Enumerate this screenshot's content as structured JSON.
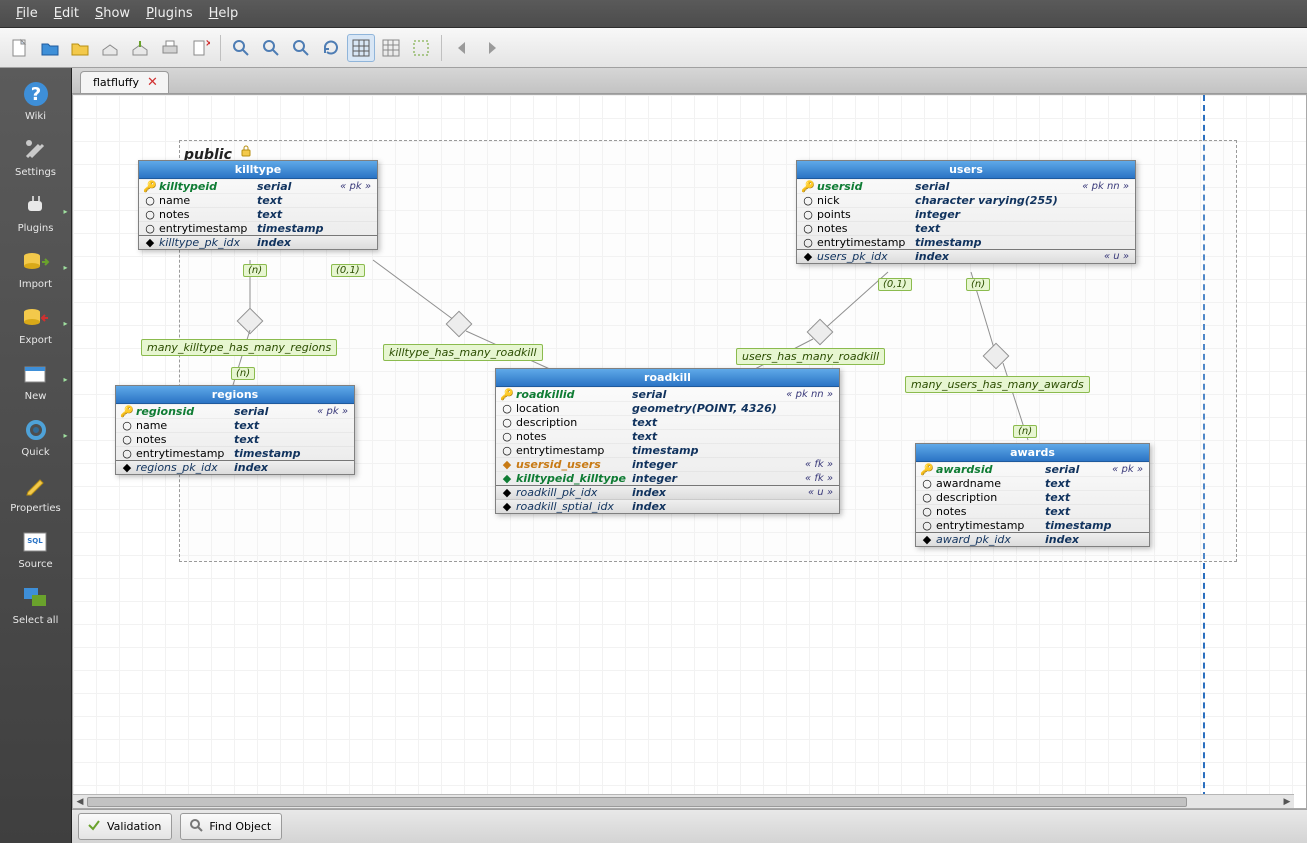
{
  "menu": {
    "file": "File",
    "edit": "Edit",
    "show": "Show",
    "plugins": "Plugins",
    "help": "Help"
  },
  "sidebar": {
    "items": [
      {
        "label": "Wiki"
      },
      {
        "label": "Settings"
      },
      {
        "label": "Plugins"
      },
      {
        "label": "Import"
      },
      {
        "label": "Export"
      },
      {
        "label": "New"
      },
      {
        "label": "Quick"
      },
      {
        "label": "Properties"
      },
      {
        "label": "Source"
      },
      {
        "label": "Select all"
      }
    ]
  },
  "tab": {
    "name": "flatfluffy"
  },
  "schema": {
    "name": "public"
  },
  "bottom": {
    "validation": "Validation",
    "find": "Find Object"
  },
  "entities": {
    "killtype": {
      "title": "killtype",
      "cols": [
        {
          "name": "killtypeid",
          "type": "serial",
          "constraint": "« pk »",
          "kind": "pk"
        },
        {
          "name": "name",
          "type": "text",
          "kind": "col"
        },
        {
          "name": "notes",
          "type": "text",
          "kind": "col"
        },
        {
          "name": "entrytimestamp",
          "type": "timestamp",
          "kind": "col"
        }
      ],
      "idx": [
        {
          "name": "killtype_pk_idx",
          "type": "index"
        }
      ]
    },
    "regions": {
      "title": "regions",
      "cols": [
        {
          "name": "regionsid",
          "type": "serial",
          "constraint": "« pk »",
          "kind": "pk"
        },
        {
          "name": "name",
          "type": "text",
          "kind": "col"
        },
        {
          "name": "notes",
          "type": "text",
          "kind": "col"
        },
        {
          "name": "entrytimestamp",
          "type": "timestamp",
          "kind": "col"
        }
      ],
      "idx": [
        {
          "name": "regions_pk_idx",
          "type": "index"
        }
      ]
    },
    "users": {
      "title": "users",
      "cols": [
        {
          "name": "usersid",
          "type": "serial",
          "constraint": "« pk nn »",
          "kind": "pk"
        },
        {
          "name": "nick",
          "type": "character varying(255)",
          "kind": "col"
        },
        {
          "name": "points",
          "type": "integer",
          "kind": "col"
        },
        {
          "name": "notes",
          "type": "text",
          "kind": "col"
        },
        {
          "name": "entrytimestamp",
          "type": "timestamp",
          "kind": "col"
        }
      ],
      "idx": [
        {
          "name": "users_pk_idx",
          "type": "index",
          "constraint": "« u »"
        }
      ]
    },
    "roadkill": {
      "title": "roadkill",
      "cols": [
        {
          "name": "roadkillid",
          "type": "serial",
          "constraint": "« pk nn »",
          "kind": "pk"
        },
        {
          "name": "location",
          "type": "geometry(POINT, 4326)",
          "kind": "col"
        },
        {
          "name": "description",
          "type": "text",
          "kind": "col"
        },
        {
          "name": "notes",
          "type": "text",
          "kind": "col"
        },
        {
          "name": "entrytimestamp",
          "type": "timestamp",
          "kind": "col"
        },
        {
          "name": "usersid_users",
          "type": "integer",
          "constraint": "« fk »",
          "kind": "fk"
        },
        {
          "name": "killtypeid_killtype",
          "type": "integer",
          "constraint": "« fk »",
          "kind": "fk2"
        }
      ],
      "idx": [
        {
          "name": "roadkill_pk_idx",
          "type": "index",
          "constraint": "« u »"
        },
        {
          "name": "roadkill_sptial_idx",
          "type": "index"
        }
      ]
    },
    "awards": {
      "title": "awards",
      "cols": [
        {
          "name": "awardsid",
          "type": "serial",
          "constraint": "« pk »",
          "kind": "pk"
        },
        {
          "name": "awardname",
          "type": "text",
          "kind": "col"
        },
        {
          "name": "description",
          "type": "text",
          "kind": "col"
        },
        {
          "name": "notes",
          "type": "text",
          "kind": "col"
        },
        {
          "name": "entrytimestamp",
          "type": "timestamp",
          "kind": "col"
        }
      ],
      "idx": [
        {
          "name": "award_pk_idx",
          "type": "index"
        }
      ]
    }
  },
  "relations": {
    "r1": {
      "label": "many_killtype_has_many_regions"
    },
    "r2": {
      "label": "killtype_has_many_roadkill"
    },
    "r3": {
      "label": "users_has_many_roadkill"
    },
    "r4": {
      "label": "many_users_has_many_awards"
    }
  },
  "cards": {
    "c1": "(n)",
    "c2": "(0,1)",
    "c3": "(n)",
    "c4": "(0,1)",
    "c5": "(n)",
    "c6": "(n)"
  }
}
